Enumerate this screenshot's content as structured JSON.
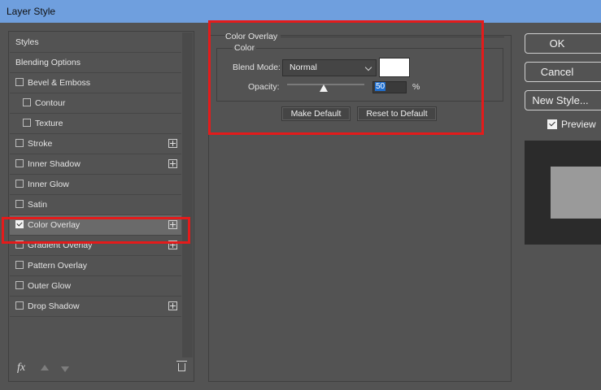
{
  "window": {
    "title": "Layer Style"
  },
  "styles_list": {
    "items": [
      {
        "label": "Styles",
        "checkbox": false,
        "plus": false,
        "indent": false,
        "checked": false,
        "selected": false
      },
      {
        "label": "Blending Options",
        "checkbox": false,
        "plus": false,
        "indent": false,
        "checked": false,
        "selected": false
      },
      {
        "label": "Bevel & Emboss",
        "checkbox": true,
        "plus": false,
        "indent": false,
        "checked": false,
        "selected": false
      },
      {
        "label": "Contour",
        "checkbox": true,
        "plus": false,
        "indent": true,
        "checked": false,
        "selected": false
      },
      {
        "label": "Texture",
        "checkbox": true,
        "plus": false,
        "indent": true,
        "checked": false,
        "selected": false
      },
      {
        "label": "Stroke",
        "checkbox": true,
        "plus": true,
        "indent": false,
        "checked": false,
        "selected": false
      },
      {
        "label": "Inner Shadow",
        "checkbox": true,
        "plus": true,
        "indent": false,
        "checked": false,
        "selected": false
      },
      {
        "label": "Inner Glow",
        "checkbox": true,
        "plus": false,
        "indent": false,
        "checked": false,
        "selected": false
      },
      {
        "label": "Satin",
        "checkbox": true,
        "plus": false,
        "indent": false,
        "checked": false,
        "selected": false
      },
      {
        "label": "Color Overlay",
        "checkbox": true,
        "plus": true,
        "indent": false,
        "checked": true,
        "selected": true
      },
      {
        "label": "Gradient Overlay",
        "checkbox": true,
        "plus": true,
        "indent": false,
        "checked": false,
        "selected": false
      },
      {
        "label": "Pattern Overlay",
        "checkbox": true,
        "plus": false,
        "indent": false,
        "checked": false,
        "selected": false
      },
      {
        "label": "Outer Glow",
        "checkbox": true,
        "plus": false,
        "indent": false,
        "checked": false,
        "selected": false
      },
      {
        "label": "Drop Shadow",
        "checkbox": true,
        "plus": true,
        "indent": false,
        "checked": false,
        "selected": false
      }
    ],
    "footer": {
      "fx_label": "fx"
    }
  },
  "color_overlay": {
    "group_title": "Color Overlay",
    "sub_title": "Color",
    "blend_mode_label": "Blend Mode:",
    "blend_mode_value": "Normal",
    "swatch_color": "#ffffff",
    "opacity_label": "Opacity:",
    "opacity_value": "50",
    "opacity_unit": "%",
    "opacity_fraction": 0.5,
    "make_default_label": "Make Default",
    "reset_default_label": "Reset to Default"
  },
  "actions": {
    "ok_label": "OK",
    "cancel_label": "Cancel",
    "new_style_label": "New Style...",
    "preview_label": "Preview",
    "preview_checked": true
  },
  "colors": {
    "highlight": "#e41b1b",
    "titlebar": "#6f9fde",
    "background": "#535353"
  }
}
